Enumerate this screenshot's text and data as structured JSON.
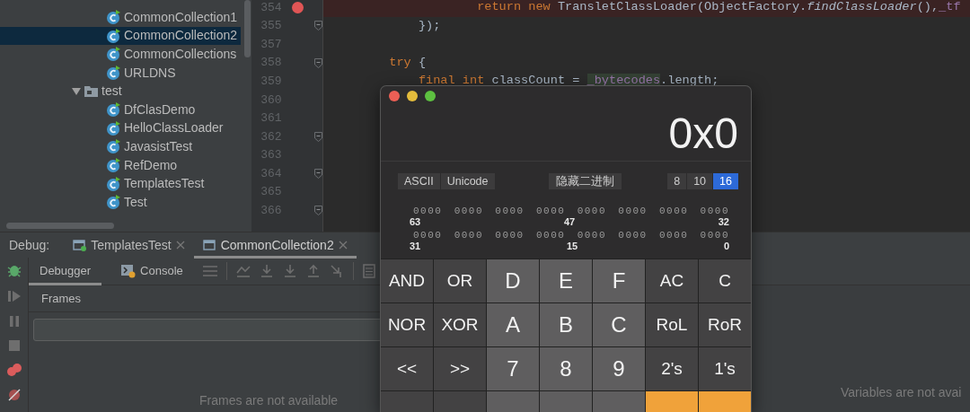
{
  "project_tree": [
    {
      "children": [
        {
          "kind": "class",
          "label": "CommonCollection1",
          "selected": false
        },
        {
          "kind": "class",
          "label": "CommonCollection2",
          "selected": true
        },
        {
          "kind": "class",
          "label": "CommonCollections",
          "selected": false
        },
        {
          "kind": "class",
          "label": "URLDNS",
          "selected": false
        }
      ]
    },
    {
      "kind": "folder",
      "label": "test",
      "expanded": true,
      "selected": false,
      "children": [
        {
          "kind": "class",
          "label": "DfClasDemo",
          "selected": false
        },
        {
          "kind": "class",
          "label": "HelloClassLoader",
          "selected": false
        },
        {
          "kind": "class",
          "label": "JavasistTest",
          "selected": false
        },
        {
          "kind": "class",
          "label": "RefDemo",
          "selected": false
        },
        {
          "kind": "class",
          "label": "TemplatesTest",
          "selected": false
        },
        {
          "kind": "class",
          "label": "Test",
          "selected": false
        }
      ]
    }
  ],
  "editor": {
    "lines": [
      {
        "number": "354",
        "breakpoint": true,
        "fold": false,
        "tokens": [
          {
            "kind": "keyword",
            "text": "                    return new "
          },
          {
            "kind": "plain",
            "text": "TransletClassLoader(ObjectFactory."
          },
          {
            "kind": "method",
            "text": "findClassLoader"
          },
          {
            "kind": "plain",
            "text": "(),"
          },
          {
            "kind": "field",
            "text": "_tf"
          }
        ]
      },
      {
        "number": "355",
        "breakpoint": false,
        "fold": true,
        "tokens": [
          {
            "kind": "plain",
            "text": "            });"
          }
        ]
      },
      {
        "number": "357",
        "breakpoint": false,
        "fold": false
      },
      {
        "number": "358",
        "breakpoint": false,
        "fold": true,
        "tokens": [
          {
            "kind": "keyword",
            "text": "        try "
          },
          {
            "kind": "plain",
            "text": "{"
          }
        ]
      },
      {
        "number": "359",
        "breakpoint": false,
        "fold": false,
        "tokens": [
          {
            "kind": "keyword",
            "text": "            final int "
          },
          {
            "kind": "plain",
            "text": "classCount = "
          },
          {
            "kind": "match",
            "text": "_bytecodes"
          },
          {
            "kind": "plain",
            "text": ".length;"
          }
        ]
      },
      {
        "number": "360",
        "breakpoint": false,
        "fold": false
      },
      {
        "number": "361",
        "breakpoint": false,
        "fold": false
      },
      {
        "number": "362",
        "breakpoint": false,
        "fold": true
      },
      {
        "number": "363",
        "breakpoint": false,
        "fold": false
      },
      {
        "number": "364",
        "breakpoint": false,
        "fold": true
      },
      {
        "number": "365",
        "breakpoint": false,
        "fold": false
      },
      {
        "number": "366",
        "breakpoint": false,
        "fold": true
      }
    ]
  },
  "debug": {
    "label": "Debug:",
    "tabs": [
      {
        "label": "TemplatesTest",
        "selected": false
      },
      {
        "label": "CommonCollection2",
        "selected": true
      }
    ],
    "subtabs": [
      {
        "kind": "debugger",
        "label": "Debugger",
        "selected": true
      },
      {
        "kind": "console",
        "label": "Console",
        "selected": false
      }
    ],
    "frames_header": "Frames",
    "frames_empty": "Frames are not available",
    "variables_empty": "Variables are not avai"
  },
  "calculator": {
    "display": "0x0",
    "encodings": [
      "ASCII",
      "Unicode"
    ],
    "binary_toggle": "隐藏二进制",
    "bases": [
      {
        "label": "8",
        "selected": false
      },
      {
        "label": "10",
        "selected": false
      },
      {
        "label": "16",
        "selected": true
      }
    ],
    "bit_rows": [
      {
        "groups": [
          "0000",
          "0000",
          "0000",
          "0000",
          "0000",
          "0000",
          "0000",
          "0000"
        ],
        "marks": [
          "63",
          "47",
          "32"
        ]
      },
      {
        "groups": [
          "0000",
          "0000",
          "0000",
          "0000",
          "0000",
          "0000",
          "0000",
          "0000"
        ],
        "marks": [
          "31",
          "15",
          "0"
        ]
      }
    ],
    "keys": [
      {
        "kind": "op",
        "label": "AND"
      },
      {
        "kind": "op",
        "label": "OR"
      },
      {
        "kind": "digit",
        "label": "D"
      },
      {
        "kind": "digit",
        "label": "E"
      },
      {
        "kind": "digit",
        "label": "F"
      },
      {
        "kind": "op",
        "label": "AC"
      },
      {
        "kind": "op",
        "label": "C"
      },
      {
        "kind": "op",
        "label": "NOR"
      },
      {
        "kind": "op",
        "label": "XOR"
      },
      {
        "kind": "digit",
        "label": "A"
      },
      {
        "kind": "digit",
        "label": "B"
      },
      {
        "kind": "digit",
        "label": "C"
      },
      {
        "kind": "op",
        "label": "RoL"
      },
      {
        "kind": "op",
        "label": "RoR"
      },
      {
        "kind": "op",
        "label": "<<"
      },
      {
        "kind": "op",
        "label": ">>"
      },
      {
        "kind": "digit",
        "label": "7"
      },
      {
        "kind": "digit",
        "label": "8"
      },
      {
        "kind": "digit",
        "label": "9"
      },
      {
        "kind": "op",
        "label": "2's"
      },
      {
        "kind": "op",
        "label": "1's"
      },
      {
        "kind": "op"
      },
      {
        "kind": "op"
      },
      {
        "kind": "digit"
      },
      {
        "kind": "digit"
      },
      {
        "kind": "digit"
      },
      {
        "kind": "accent"
      },
      {
        "kind": "accent"
      }
    ]
  }
}
